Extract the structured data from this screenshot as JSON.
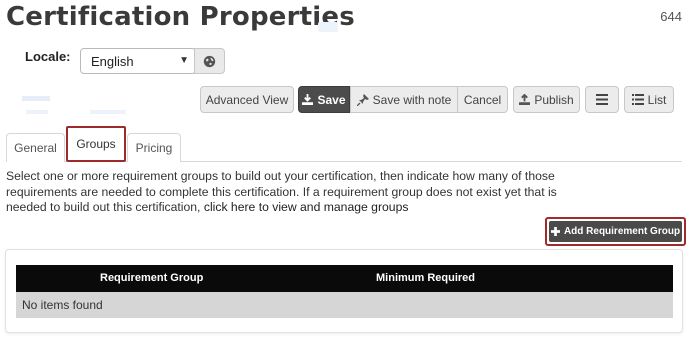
{
  "page": {
    "title": "Certification Properties",
    "record_id": "644"
  },
  "locale": {
    "label": "Locale:",
    "selected": "English"
  },
  "toolbar": {
    "advanced_view": "Advanced View",
    "save": "Save",
    "save_with_note": "Save with note",
    "cancel": "Cancel",
    "publish": "Publish",
    "list": "List"
  },
  "tabs": [
    {
      "label": "General",
      "active": false
    },
    {
      "label": "Groups",
      "active": true
    },
    {
      "label": "Pricing",
      "active": false
    }
  ],
  "description": {
    "text": "Select one or more requirement groups to build out your certification, then indicate how many of those requirements are needed to complete this certification. If a requirement group does not exist yet that is needed to build out this certification, ",
    "link": "click here to view and manage groups"
  },
  "add_group_button": "Add Requirement Group",
  "table": {
    "columns": [
      "Requirement Group",
      "Minimum Required"
    ],
    "empty_message": "No items found"
  },
  "colors": {
    "dark_button": "#4c4c4c",
    "highlight_border": "#9e2a2a",
    "table_header": "#0a0a0a",
    "empty_row": "#d6d6d6"
  }
}
